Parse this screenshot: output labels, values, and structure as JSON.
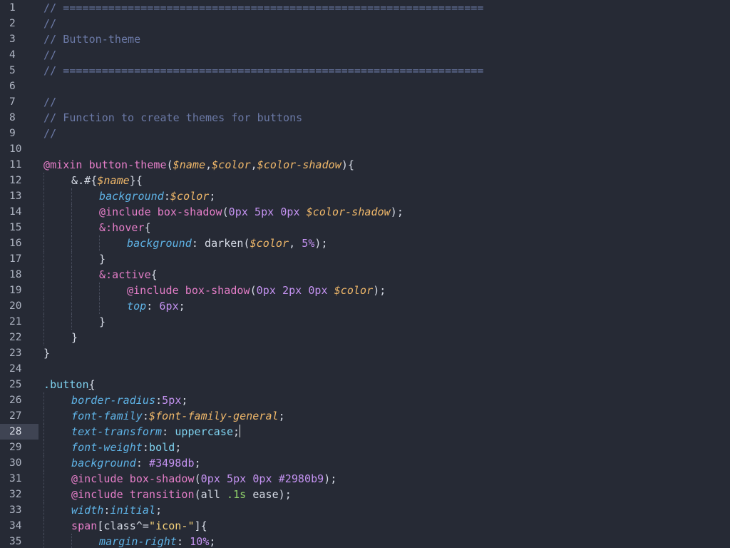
{
  "editor": {
    "active_line": 28,
    "colors": {
      "background": "#262a35",
      "comment": "#6b79a6",
      "at_rule": "#e57ec8",
      "function": "#e57ec8",
      "variable": "#f0b86a",
      "property": "#5fb3e6",
      "number": "#c593f2",
      "selector": "#7fd3f0",
      "plain": "#d6dbe6",
      "string": "#f7d37a",
      "hex": "#c593f2"
    },
    "lines": [
      {
        "num": "1",
        "indent": 0,
        "tokens": [
          {
            "t": "// =================================================================",
            "c": "comment"
          }
        ]
      },
      {
        "num": "2",
        "indent": 0,
        "tokens": [
          {
            "t": "//",
            "c": "comment"
          }
        ]
      },
      {
        "num": "3",
        "indent": 0,
        "tokens": [
          {
            "t": "// Button-theme",
            "c": "comment"
          }
        ]
      },
      {
        "num": "4",
        "indent": 0,
        "tokens": [
          {
            "t": "//",
            "c": "comment"
          }
        ]
      },
      {
        "num": "5",
        "indent": 0,
        "tokens": [
          {
            "t": "// =================================================================",
            "c": "comment"
          }
        ]
      },
      {
        "num": "6",
        "indent": 0,
        "tokens": []
      },
      {
        "num": "7",
        "indent": 0,
        "tokens": [
          {
            "t": "//",
            "c": "comment"
          }
        ]
      },
      {
        "num": "8",
        "indent": 0,
        "tokens": [
          {
            "t": "// Function to create themes for buttons",
            "c": "comment"
          }
        ]
      },
      {
        "num": "9",
        "indent": 0,
        "tokens": [
          {
            "t": "//",
            "c": "comment"
          }
        ]
      },
      {
        "num": "10",
        "indent": 0,
        "tokens": []
      },
      {
        "num": "11",
        "indent": 0,
        "tokens": [
          {
            "t": "@mixin",
            "c": "at_rule"
          },
          {
            "t": " ",
            "c": "plain"
          },
          {
            "t": "button-theme",
            "c": "function"
          },
          {
            "t": "(",
            "c": "plain"
          },
          {
            "t": "$name",
            "c": "variable",
            "i": true
          },
          {
            "t": ",",
            "c": "plain"
          },
          {
            "t": "$color",
            "c": "variable",
            "i": true
          },
          {
            "t": ",",
            "c": "plain"
          },
          {
            "t": "$color-shadow",
            "c": "variable",
            "i": true
          },
          {
            "t": "){",
            "c": "plain"
          }
        ]
      },
      {
        "num": "12",
        "indent": 1,
        "tokens": [
          {
            "t": "&.#{",
            "c": "plain"
          },
          {
            "t": "$name",
            "c": "variable",
            "i": true
          },
          {
            "t": "}{",
            "c": "plain"
          }
        ]
      },
      {
        "num": "13",
        "indent": 2,
        "tokens": [
          {
            "t": "background",
            "c": "property",
            "i": true
          },
          {
            "t": ":",
            "c": "plain"
          },
          {
            "t": "$color",
            "c": "variable",
            "i": true
          },
          {
            "t": ";",
            "c": "plain"
          }
        ]
      },
      {
        "num": "14",
        "indent": 2,
        "tokens": [
          {
            "t": "@include",
            "c": "at_rule"
          },
          {
            "t": " ",
            "c": "plain"
          },
          {
            "t": "box-shadow",
            "c": "function"
          },
          {
            "t": "(",
            "c": "plain"
          },
          {
            "t": "0px",
            "c": "number"
          },
          {
            "t": " ",
            "c": "plain"
          },
          {
            "t": "5px",
            "c": "number"
          },
          {
            "t": " ",
            "c": "plain"
          },
          {
            "t": "0px",
            "c": "number"
          },
          {
            "t": " ",
            "c": "plain"
          },
          {
            "t": "$color-shadow",
            "c": "variable",
            "i": true
          },
          {
            "t": ");",
            "c": "plain"
          }
        ]
      },
      {
        "num": "15",
        "indent": 2,
        "tokens": [
          {
            "t": "&:hover",
            "c": "at_rule"
          },
          {
            "t": "{",
            "c": "plain"
          }
        ]
      },
      {
        "num": "16",
        "indent": 3,
        "tokens": [
          {
            "t": "background",
            "c": "property",
            "i": true
          },
          {
            "t": ": ",
            "c": "plain"
          },
          {
            "t": "darken",
            "c": "plain"
          },
          {
            "t": "(",
            "c": "plain"
          },
          {
            "t": "$color",
            "c": "variable",
            "i": true
          },
          {
            "t": ", ",
            "c": "plain"
          },
          {
            "t": "5%",
            "c": "number"
          },
          {
            "t": ");",
            "c": "plain"
          }
        ]
      },
      {
        "num": "17",
        "indent": 2,
        "tokens": [
          {
            "t": "}",
            "c": "plain"
          }
        ]
      },
      {
        "num": "18",
        "indent": 2,
        "tokens": [
          {
            "t": "&:active",
            "c": "at_rule"
          },
          {
            "t": "{",
            "c": "plain"
          }
        ]
      },
      {
        "num": "19",
        "indent": 3,
        "tokens": [
          {
            "t": "@include",
            "c": "at_rule"
          },
          {
            "t": " ",
            "c": "plain"
          },
          {
            "t": "box-shadow",
            "c": "function"
          },
          {
            "t": "(",
            "c": "plain"
          },
          {
            "t": "0px",
            "c": "number"
          },
          {
            "t": " ",
            "c": "plain"
          },
          {
            "t": "2px",
            "c": "number"
          },
          {
            "t": " ",
            "c": "plain"
          },
          {
            "t": "0px",
            "c": "number"
          },
          {
            "t": " ",
            "c": "plain"
          },
          {
            "t": "$color",
            "c": "variable",
            "i": true
          },
          {
            "t": ");",
            "c": "plain"
          }
        ]
      },
      {
        "num": "20",
        "indent": 3,
        "tokens": [
          {
            "t": "top",
            "c": "property",
            "i": true
          },
          {
            "t": ": ",
            "c": "plain"
          },
          {
            "t": "6px",
            "c": "number"
          },
          {
            "t": ";",
            "c": "plain"
          }
        ]
      },
      {
        "num": "21",
        "indent": 2,
        "tokens": [
          {
            "t": "}",
            "c": "plain"
          }
        ]
      },
      {
        "num": "22",
        "indent": 1,
        "tokens": [
          {
            "t": "}",
            "c": "plain"
          }
        ]
      },
      {
        "num": "23",
        "indent": 0,
        "tokens": [
          {
            "t": "}",
            "c": "plain"
          }
        ]
      },
      {
        "num": "24",
        "indent": 0,
        "tokens": []
      },
      {
        "num": "25",
        "indent": 0,
        "tokens": [
          {
            "t": ".button",
            "c": "selector"
          },
          {
            "t": "{",
            "c": "plain",
            "u": true
          }
        ]
      },
      {
        "num": "26",
        "indent": 1,
        "tokens": [
          {
            "t": "border-radius",
            "c": "property",
            "i": true
          },
          {
            "t": ":",
            "c": "plain"
          },
          {
            "t": "5px",
            "c": "number"
          },
          {
            "t": ";",
            "c": "plain"
          }
        ]
      },
      {
        "num": "27",
        "indent": 1,
        "tokens": [
          {
            "t": "font-family",
            "c": "property",
            "i": true
          },
          {
            "t": ":",
            "c": "plain"
          },
          {
            "t": "$font-family-general",
            "c": "variable",
            "i": true
          },
          {
            "t": ";",
            "c": "plain"
          }
        ]
      },
      {
        "num": "28",
        "indent": 1,
        "tokens": [
          {
            "t": "text-transform",
            "c": "property",
            "i": true
          },
          {
            "t": ": ",
            "c": "plain"
          },
          {
            "t": "uppercase",
            "c": "selector"
          },
          {
            "t": ";",
            "c": "plain"
          }
        ],
        "cursor": true
      },
      {
        "num": "29",
        "indent": 1,
        "tokens": [
          {
            "t": "font-weight",
            "c": "property",
            "i": true
          },
          {
            "t": ":",
            "c": "plain"
          },
          {
            "t": "bold",
            "c": "selector"
          },
          {
            "t": ";",
            "c": "plain"
          }
        ]
      },
      {
        "num": "30",
        "indent": 1,
        "tokens": [
          {
            "t": "background",
            "c": "property",
            "i": true
          },
          {
            "t": ": ",
            "c": "plain"
          },
          {
            "t": "#3498db",
            "c": "hex"
          },
          {
            "t": ";",
            "c": "plain"
          }
        ]
      },
      {
        "num": "31",
        "indent": 1,
        "tokens": [
          {
            "t": "@include",
            "c": "at_rule"
          },
          {
            "t": " ",
            "c": "plain"
          },
          {
            "t": "box-shadow",
            "c": "function"
          },
          {
            "t": "(",
            "c": "plain"
          },
          {
            "t": "0px",
            "c": "number"
          },
          {
            "t": " ",
            "c": "plain"
          },
          {
            "t": "5px",
            "c": "number"
          },
          {
            "t": " ",
            "c": "plain"
          },
          {
            "t": "0px",
            "c": "number"
          },
          {
            "t": " ",
            "c": "plain"
          },
          {
            "t": "#2980b9",
            "c": "hex"
          },
          {
            "t": ");",
            "c": "plain"
          }
        ]
      },
      {
        "num": "32",
        "indent": 1,
        "tokens": [
          {
            "t": "@include",
            "c": "at_rule"
          },
          {
            "t": " ",
            "c": "plain"
          },
          {
            "t": "transition",
            "c": "function"
          },
          {
            "t": "(",
            "c": "plain"
          },
          {
            "t": "all",
            "c": "plain"
          },
          {
            "t": " ",
            "c": "plain"
          },
          {
            "t": ".1s",
            "c": "string_green"
          },
          {
            "t": " ",
            "c": "plain"
          },
          {
            "t": "ease",
            "c": "plain"
          },
          {
            "t": ");",
            "c": "plain"
          }
        ]
      },
      {
        "num": "33",
        "indent": 1,
        "tokens": [
          {
            "t": "width",
            "c": "property",
            "i": true
          },
          {
            "t": ":",
            "c": "plain"
          },
          {
            "t": "initial",
            "c": "property",
            "i": true
          },
          {
            "t": ";",
            "c": "plain"
          }
        ]
      },
      {
        "num": "34",
        "indent": 1,
        "tokens": [
          {
            "t": "span",
            "c": "at_rule"
          },
          {
            "t": "[class^=",
            "c": "plain"
          },
          {
            "t": "\"icon-\"",
            "c": "string"
          },
          {
            "t": "]{",
            "c": "plain"
          }
        ]
      },
      {
        "num": "35",
        "indent": 2,
        "tokens": [
          {
            "t": "margin-right",
            "c": "property",
            "i": true
          },
          {
            "t": ": ",
            "c": "plain"
          },
          {
            "t": "10%",
            "c": "number"
          },
          {
            "t": ";",
            "c": "plain"
          }
        ]
      }
    ]
  }
}
